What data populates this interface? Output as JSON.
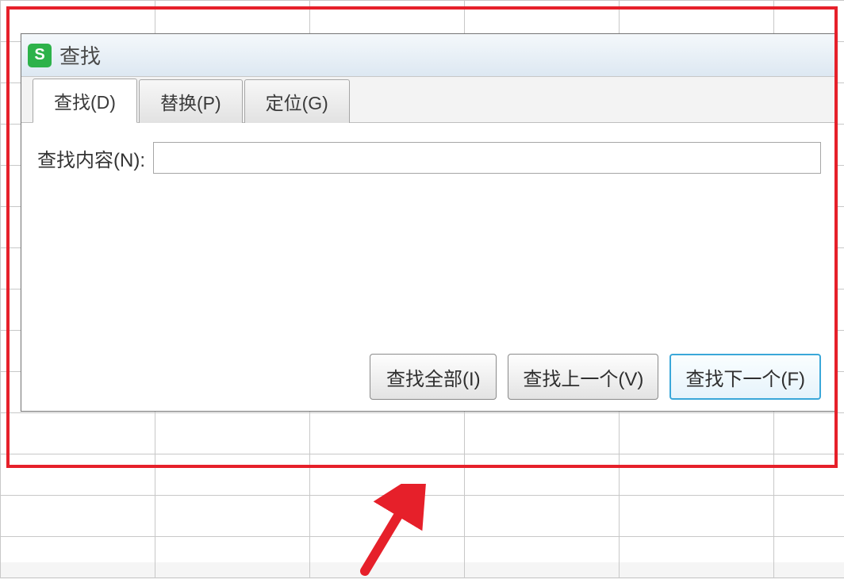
{
  "dialog": {
    "title": "查找",
    "app_icon_letter": "S",
    "tabs": [
      {
        "label": "查找(D)",
        "active": true
      },
      {
        "label": "替换(P)",
        "active": false
      },
      {
        "label": "定位(G)",
        "active": false
      }
    ],
    "find_label": "查找内容(N):",
    "find_value": "",
    "buttons": {
      "find_all": "查找全部(I)",
      "find_prev": "查找上一个(V)",
      "find_next": "查找下一个(F)"
    }
  },
  "annotation": {
    "highlight_color": "#e6202a",
    "arrow_color": "#e6202a"
  }
}
